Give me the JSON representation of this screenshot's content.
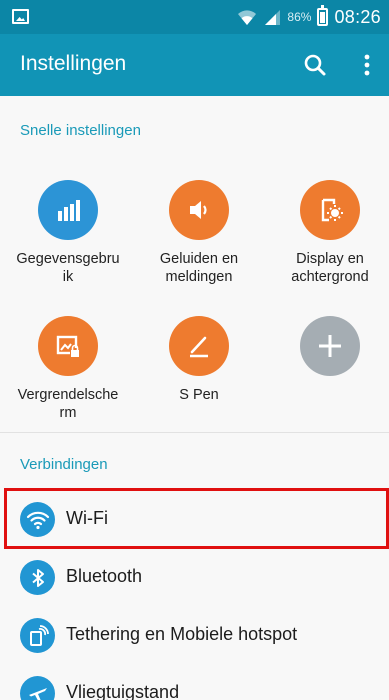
{
  "status_bar": {
    "battery_percent": "86%",
    "time": "08:26",
    "icons": [
      "gallery-icon",
      "wifi-signal-icon",
      "cell-signal-icon",
      "battery-icon"
    ]
  },
  "app_bar": {
    "title": "Instellingen",
    "icons": [
      "search-icon",
      "more-vertical-icon"
    ]
  },
  "quick_settings": {
    "header": "Snelle instellingen",
    "items": [
      {
        "label": "Gegevensgebruik",
        "icon": "data-usage-icon",
        "color": "#2c94d6"
      },
      {
        "label": "Geluiden en meldingen",
        "icon": "volume-icon",
        "color": "#ee7b2f"
      },
      {
        "label": "Display en achtergrond",
        "icon": "display-icon",
        "color": "#ee7b2f"
      },
      {
        "label": "Vergrendelscherm",
        "icon": "lock-screen-icon",
        "color": "#ee7b2f"
      },
      {
        "label": "S Pen",
        "icon": "pen-icon",
        "color": "#ee7b2f"
      },
      {
        "label": "",
        "icon": "add-icon",
        "color": "#a5adb3"
      }
    ]
  },
  "connections": {
    "header": "Verbindingen",
    "items": [
      {
        "label": "Wi-Fi",
        "icon": "wifi-icon"
      },
      {
        "label": "Bluetooth",
        "icon": "bluetooth-icon"
      },
      {
        "label": "Tethering en Mobiele hotspot",
        "icon": "hotspot-icon"
      },
      {
        "label": "Vliegtuigstand",
        "icon": "airplane-icon"
      }
    ]
  },
  "colors": {
    "status_bar": "#0c86a6",
    "app_bar": "#1194b6",
    "section_header": "#1a9ab8",
    "connection_icon": "#2196d3",
    "highlight": "#e01010"
  }
}
